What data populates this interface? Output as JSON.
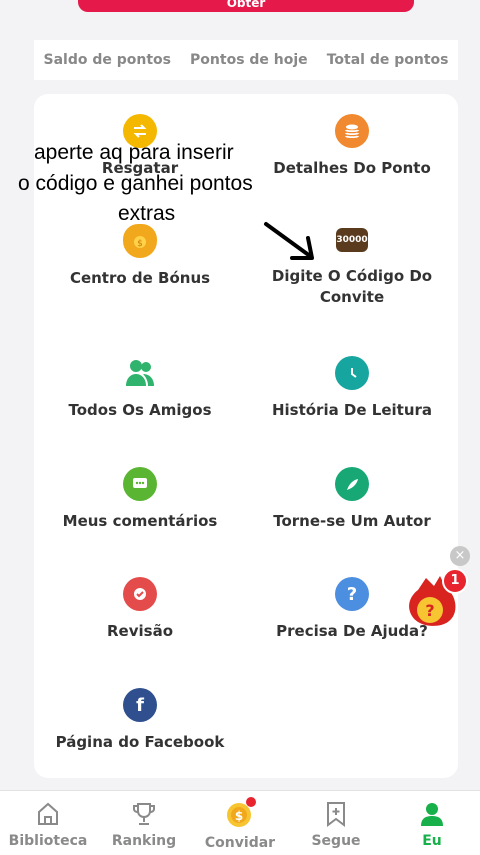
{
  "banner": {
    "label": "Obter"
  },
  "points": {
    "saldo": "Saldo de pontos",
    "hoje": "Pontos de hoje",
    "total": "Total de pontos"
  },
  "menu": [
    {
      "label": "Resgatar"
    },
    {
      "label": "Detalhes Do Ponto"
    },
    {
      "label": "Centro de Bónus"
    },
    {
      "label": "Digite O Código Do Convite"
    },
    {
      "label": "Todos Os Amigos"
    },
    {
      "label": "História De Leitura"
    },
    {
      "label": "Meus comentários"
    },
    {
      "label": "Torne-se Um Autor"
    },
    {
      "label": "Revisão"
    },
    {
      "label": "Precisa De Ajuda?"
    },
    {
      "label": "Página do Facebook"
    }
  ],
  "badge_value": "30000",
  "overlay": {
    "line1": "aperte aq para inserir",
    "line2": "o código e ganhei pontos",
    "line3": "extras"
  },
  "float_badge": {
    "count": "1"
  },
  "tabs": [
    {
      "label": "Biblioteca"
    },
    {
      "label": "Ranking"
    },
    {
      "label": "Convidar"
    },
    {
      "label": "Segue"
    },
    {
      "label": "Eu"
    }
  ],
  "colors": {
    "accent_green": "#18b04a",
    "orange": "#f0892f",
    "teal": "#17a5a0",
    "red": "#e44c4c",
    "blue": "#4c8ee0",
    "facebook": "#2f4f8e"
  }
}
